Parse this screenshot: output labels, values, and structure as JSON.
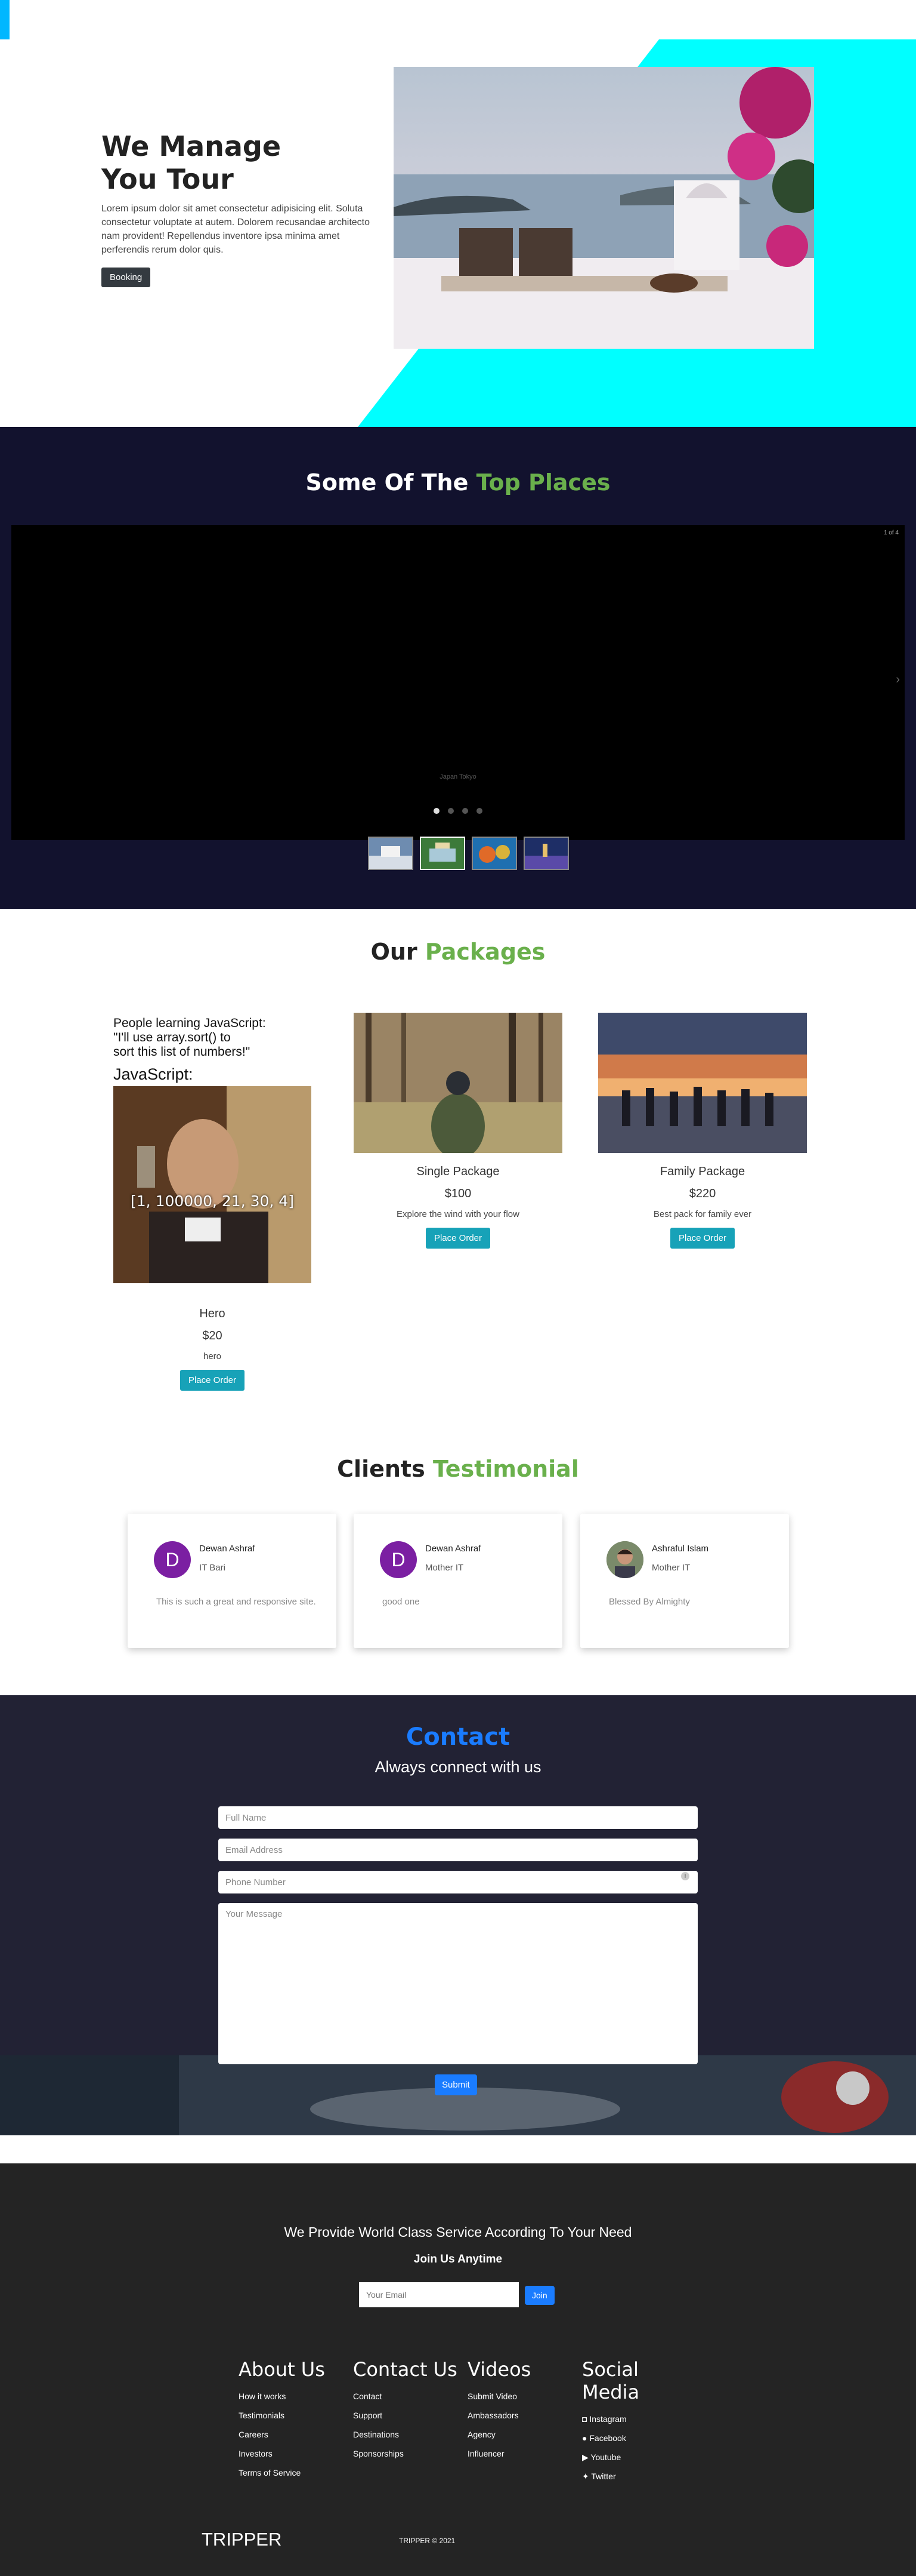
{
  "hero": {
    "title": "We Manage\nYou Tour",
    "description": "Lorem ipsum dolor sit amet consectetur adipisicing elit. Soluta consectetur voluptate at autem. Dolorem recusandae architecto nam provident! Repellendus inventore ipsa minima amet perferendis rerum dolor quis.",
    "button": "Booking"
  },
  "places": {
    "title_a": "Some Of The ",
    "title_b": "Top Places",
    "counter": "1 of 4",
    "caption": "Japan Tokyo",
    "next_icon": "chevron-right-icon"
  },
  "packages": {
    "title_a": "Our ",
    "title_b": "Packages",
    "meme": {
      "caption": "People learning JavaScript:\n\"I'll use array.sort() to\nsort this list of numbers!\"",
      "label": "JavaScript:",
      "array": "[1, 100000, 21, 30, 4]"
    },
    "items": [
      {
        "name": "Hero",
        "price": "$20",
        "desc": "hero",
        "button": "Place Order"
      },
      {
        "name": "Single Package",
        "price": "$100",
        "desc": "Explore the wind with your flow",
        "button": "Place Order"
      },
      {
        "name": "Family Package",
        "price": "$220",
        "desc": "Best pack for family ever",
        "button": "Place Order"
      }
    ]
  },
  "testimonials": {
    "title_a": "Clients ",
    "title_b": "Testimonial",
    "items": [
      {
        "initial": "D",
        "name": "Dewan Ashraf",
        "role": "IT Bari",
        "quote": "This is such a great and responsive site."
      },
      {
        "initial": "D",
        "name": "Dewan Ashraf",
        "role": "Mother IT",
        "quote": "good one"
      },
      {
        "initial": "",
        "name": "Ashraful Islam",
        "role": "Mother IT",
        "quote": "Blessed By Almighty"
      }
    ]
  },
  "contact": {
    "title": "Contact",
    "subtitle": "Always connect with us",
    "fullname_placeholder": "Full Name",
    "email_placeholder": "Email Address",
    "phone_placeholder": "Phone Number",
    "message_placeholder": "Your Message",
    "submit": "Submit"
  },
  "footer": {
    "headline": "We Provide World Class Service According To Your Need",
    "subline": "Join Us Anytime",
    "email_placeholder": "Your Email",
    "join": "Join",
    "columns": [
      {
        "title": "About Us",
        "links": [
          "How it works",
          "Testimonials",
          "Careers",
          "Investors",
          "Terms of Service"
        ]
      },
      {
        "title": "Contact Us",
        "links": [
          "Contact",
          "Support",
          "Destinations",
          "Sponsorships"
        ]
      },
      {
        "title": "Videos",
        "links": [
          "Submit Video",
          "Ambassadors",
          "Agency",
          "Influencer"
        ]
      },
      {
        "title": "Social Media",
        "links": [
          "Instagram",
          "Facebook",
          "Youtube",
          "Twitter"
        ]
      }
    ],
    "brand": "TRIPPER",
    "copyright": "TRIPPER © 2021"
  }
}
